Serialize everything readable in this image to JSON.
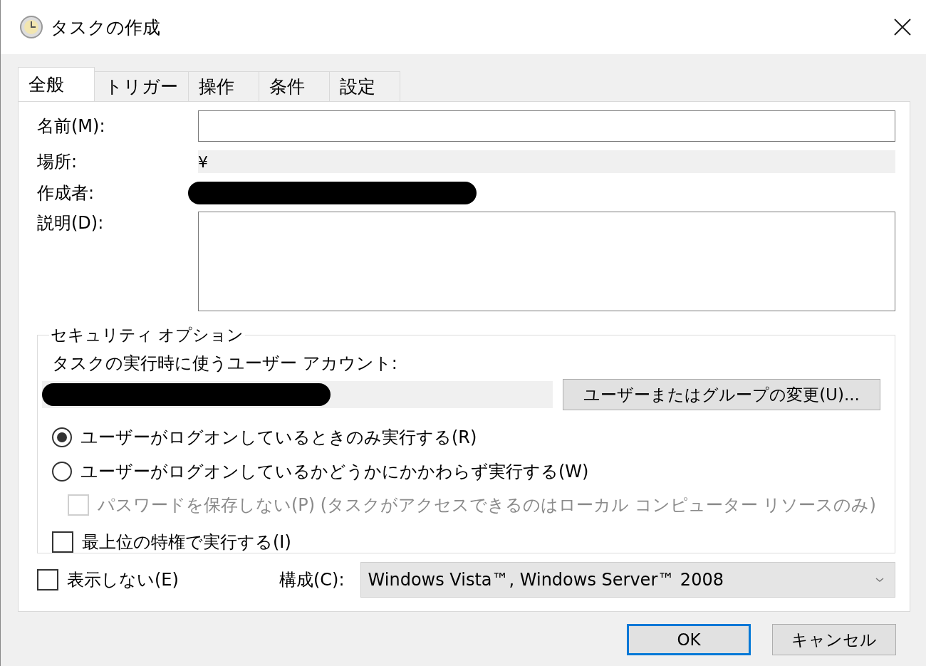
{
  "window": {
    "title": "タスクの作成"
  },
  "tabs": [
    {
      "label": "全般",
      "selected": true
    },
    {
      "label": "トリガー",
      "selected": false
    },
    {
      "label": "操作",
      "selected": false
    },
    {
      "label": "条件",
      "selected": false
    },
    {
      "label": "設定",
      "selected": false
    }
  ],
  "name_field": {
    "label": "名前(M):"
  },
  "location_field": {
    "label": "場所:",
    "value": "¥"
  },
  "author_field": {
    "label": "作成者:"
  },
  "description_field": {
    "label": "説明(D):"
  },
  "security": {
    "title": "セキュリティ オプション",
    "account_label": "タスクの実行時に使うユーザー アカウント:",
    "change_button": "ユーザーまたはグループの変更(U)...",
    "run_options": [
      {
        "label": "ユーザーがログオンしているときのみ実行する(R)",
        "selected": true
      },
      {
        "label": "ユーザーがログオンしているかどうかにかかわらず実行する(W)",
        "selected": false,
        "children": [
          {
            "label": "パスワードを保存しない(P) (タスクがアクセスできるのはローカル コンピューター リソースのみ)",
            "checked": false,
            "disabled": true
          }
        ]
      }
    ],
    "highest_privileges": {
      "label": "最上位の特権で実行する(I)",
      "checked": false,
      "disabled": false
    }
  },
  "hidden_checkbox": {
    "label": "表示しない(E)",
    "checked": false,
    "disabled": false
  },
  "configure": {
    "label": "構成(C):",
    "value": "Windows Vista™, Windows Server™ 2008"
  },
  "buttons": [
    {
      "label": "OK",
      "default": true
    },
    {
      "label": "キャンセル",
      "default": false
    }
  ]
}
